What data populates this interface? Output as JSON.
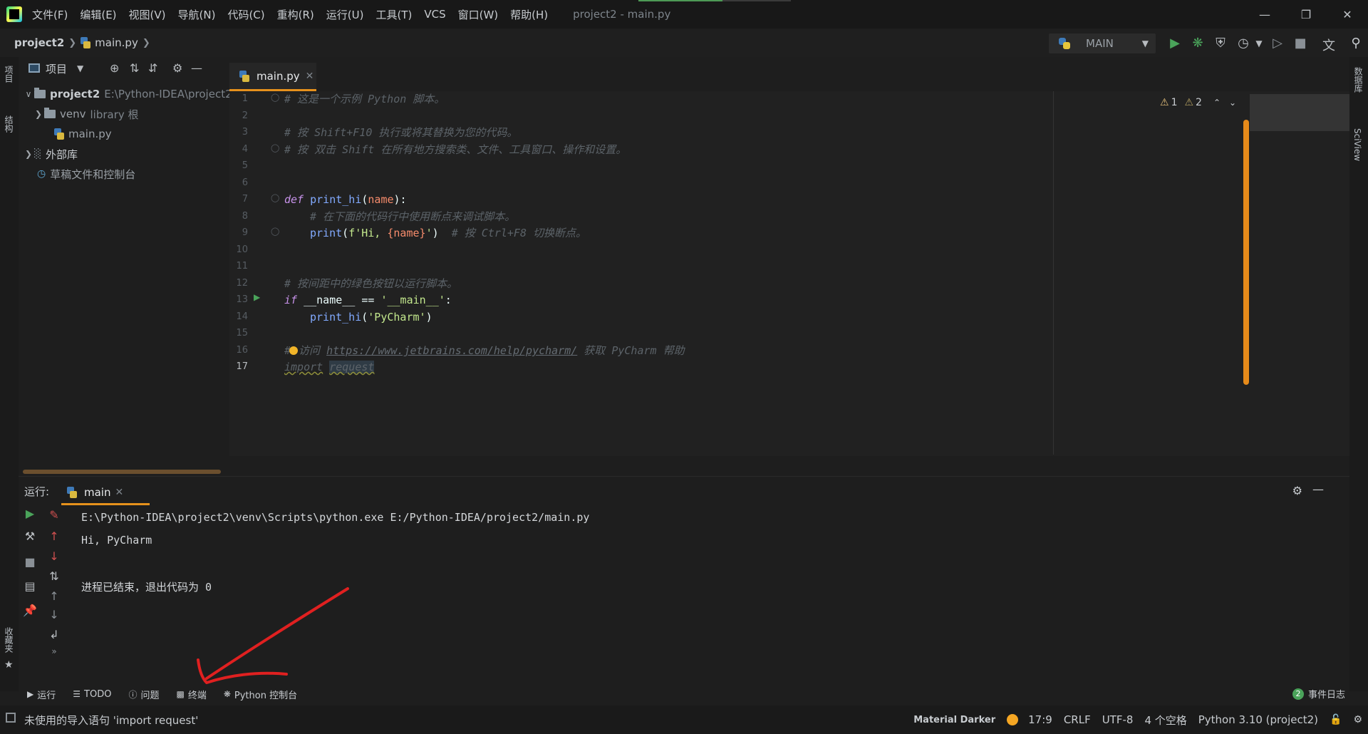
{
  "menu": {
    "items": [
      "文件(F)",
      "编辑(E)",
      "视图(V)",
      "导航(N)",
      "代码(C)",
      "重构(R)",
      "运行(U)",
      "工具(T)",
      "VCS",
      "窗口(W)",
      "帮助(H)"
    ],
    "window_title": "project2 - main.py"
  },
  "navbar": {
    "project": "project2",
    "file": "main.py",
    "run_config": "MAIN"
  },
  "left_strip": {
    "project_tab": "项目",
    "structure_tab": "结构",
    "favorites_tab": "收藏夹"
  },
  "right_strip": {
    "database_tab": "数据库",
    "sciview_tab": "SciView"
  },
  "project_panel": {
    "title": "项目",
    "tree": {
      "root_name": "project2",
      "root_path": "E:\\Python-IDEA\\project2",
      "venv": "venv",
      "venv_note": "library 根",
      "main_file": "main.py",
      "external_libs": "外部库",
      "scratches": "草稿文件和控制台"
    }
  },
  "editor": {
    "tab_label": "main.py",
    "inspections": {
      "warnings": "1",
      "weak_warnings": "2"
    },
    "lines": {
      "l1": "# 这是一个示例 Python 脚本。",
      "l3": "# 按 Shift+F10 执行或将其替换为您的代码。",
      "l4": "# 按 双击 Shift 在所有地方搜索类、文件、工具窗口、操作和设置。",
      "l7_def": "def",
      "l7_name": "print_hi",
      "l7_param": "name",
      "l8": "# 在下面的代码行中使用断点来调试脚本。",
      "l9_fn": "print",
      "l9_str_a": "f'Hi, ",
      "l9_str_b": "{name}",
      "l9_str_c": "'",
      "l9_comment": "# 按 Ctrl+F8 切换断点。",
      "l12": "# 按间距中的绿色按钮以运行脚本。",
      "l13_if": "if",
      "l13_rest": "__name__ == ",
      "l13_str": "'__main__'",
      "l14_fn": "print_hi",
      "l14_str": "'PyCharm'",
      "l16_prefix": "#",
      "l16_mid": "访问",
      "l16_url": "https://www.jetbrains.com/help/pycharm/",
      "l16_suffix": " 获取 PyCharm 帮助",
      "l17_kw": "import",
      "l17_mod": "request"
    }
  },
  "run_panel": {
    "title": "运行:",
    "tab_label": "main",
    "output": {
      "command": "E:\\Python-IDEA\\project2\\venv\\Scripts\\python.exe E:/Python-IDEA/project2/main.py",
      "line1": "Hi, PyCharm",
      "exit": "进程已结束，退出代码为 0"
    }
  },
  "bottom_tools": {
    "run": "运行",
    "todo": "TODO",
    "problems": "问题",
    "terminal": "终端",
    "python_console": "Python 控制台",
    "event_log": "事件日志",
    "event_count": "2"
  },
  "statusbar": {
    "message": "未使用的导入语句 'import request'",
    "theme": "Material Darker",
    "position": "17:9",
    "line_sep": "CRLF",
    "encoding": "UTF-8",
    "indent": "4 个空格",
    "interpreter": "Python 3.10 (project2)"
  },
  "colors": {
    "accent": "#e6911c",
    "run_green": "#4aa35a",
    "annotation_red": "#e02020"
  }
}
